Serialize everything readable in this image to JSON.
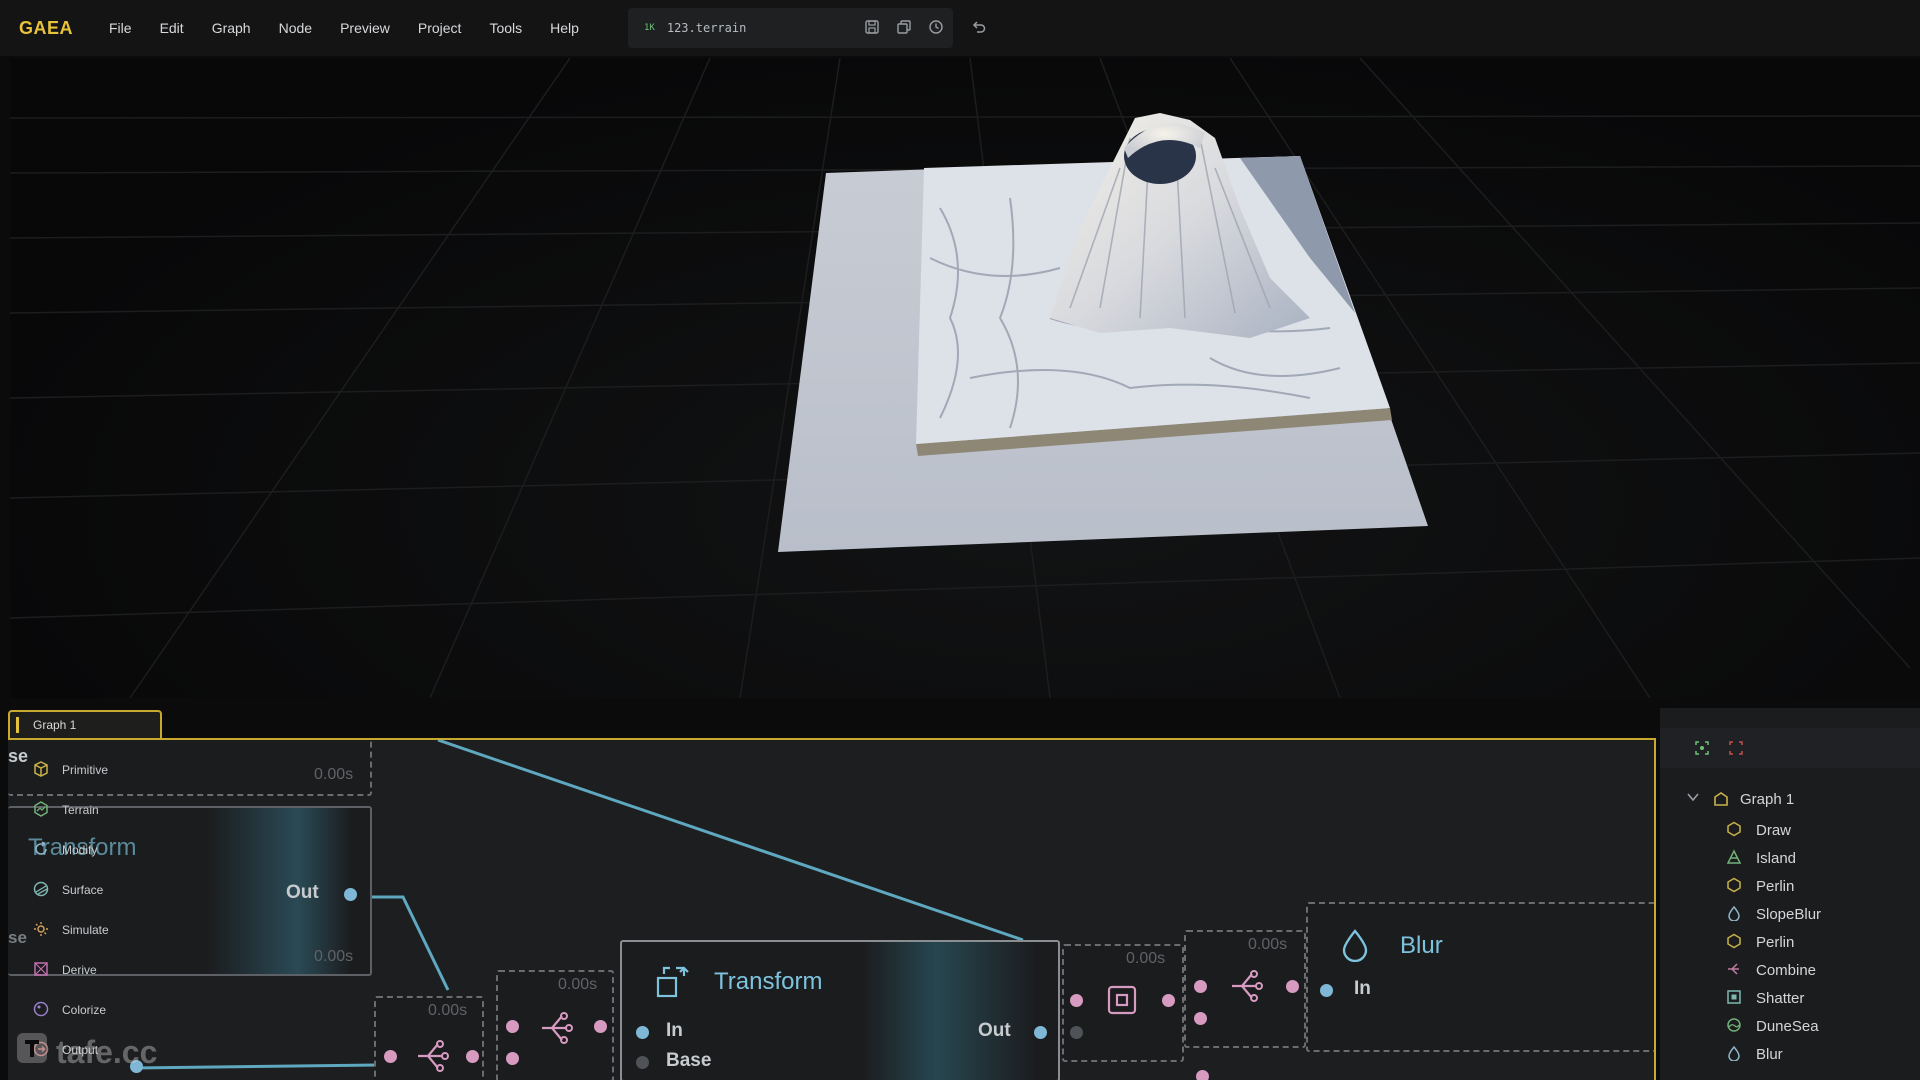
{
  "app": {
    "logo": "GAEA"
  },
  "menu": [
    "File",
    "Edit",
    "Graph",
    "Node",
    "Preview",
    "Project",
    "Tools",
    "Help"
  ],
  "file": {
    "resolution": "1K",
    "name": "123.terrain"
  },
  "graph_tab": {
    "label": "Graph 1"
  },
  "categories": [
    {
      "label": "Primitive",
      "icon": "cube-icon",
      "color": "#c9b24a"
    },
    {
      "label": "Terrain",
      "icon": "hexagon-icon",
      "color": "#73b27a"
    },
    {
      "label": "Modify",
      "icon": "cycle-icon",
      "color": "#8fb4c9"
    },
    {
      "label": "Surface",
      "icon": "surface-icon",
      "color": "#7fb8b0"
    },
    {
      "label": "Simulate",
      "icon": "simulate-icon",
      "color": "#d1a15a"
    },
    {
      "label": "Derive",
      "icon": "derive-icon",
      "color": "#c06fae"
    },
    {
      "label": "Colorize",
      "icon": "colorize-icon",
      "color": "#9a7fc9"
    },
    {
      "label": "Output",
      "icon": "output-icon",
      "color": "#c07070"
    }
  ],
  "nodes": {
    "partial_top": {
      "title": "se",
      "time": "0.00s"
    },
    "partial_transform": {
      "title": "Transform",
      "out": "Out",
      "time": "0.00s",
      "side": "se"
    },
    "combine_a": {
      "time": "0.00s"
    },
    "combine_b": {
      "time": "0.00s"
    },
    "transform": {
      "title": "Transform",
      "in": "In",
      "base": "Base",
      "out": "Out"
    },
    "shatter": {
      "time": "0.00s"
    },
    "combine_c": {
      "time": "0.00s"
    },
    "blur": {
      "title": "Blur",
      "in": "In"
    }
  },
  "tree": {
    "root": "Graph 1",
    "items": [
      {
        "label": "Draw",
        "icon": "hexagon-icon",
        "color": "#c9b24a"
      },
      {
        "label": "Island",
        "icon": "mountain-icon",
        "color": "#73b27a"
      },
      {
        "label": "Perlin",
        "icon": "hexagon-icon",
        "color": "#c9b24a"
      },
      {
        "label": "SlopeBlur",
        "icon": "drop-icon",
        "color": "#8fb4c9"
      },
      {
        "label": "Perlin",
        "icon": "hexagon-icon",
        "color": "#c9b24a"
      },
      {
        "label": "Combine",
        "icon": "combine-icon",
        "color": "#c07aa0"
      },
      {
        "label": "Shatter",
        "icon": "shatter-icon",
        "color": "#7fb8b0"
      },
      {
        "label": "DuneSea",
        "icon": "dune-icon",
        "color": "#73b27a"
      },
      {
        "label": "Blur",
        "icon": "drop-icon",
        "color": "#8fb4c9"
      }
    ]
  },
  "watermark": "tafe.cc"
}
